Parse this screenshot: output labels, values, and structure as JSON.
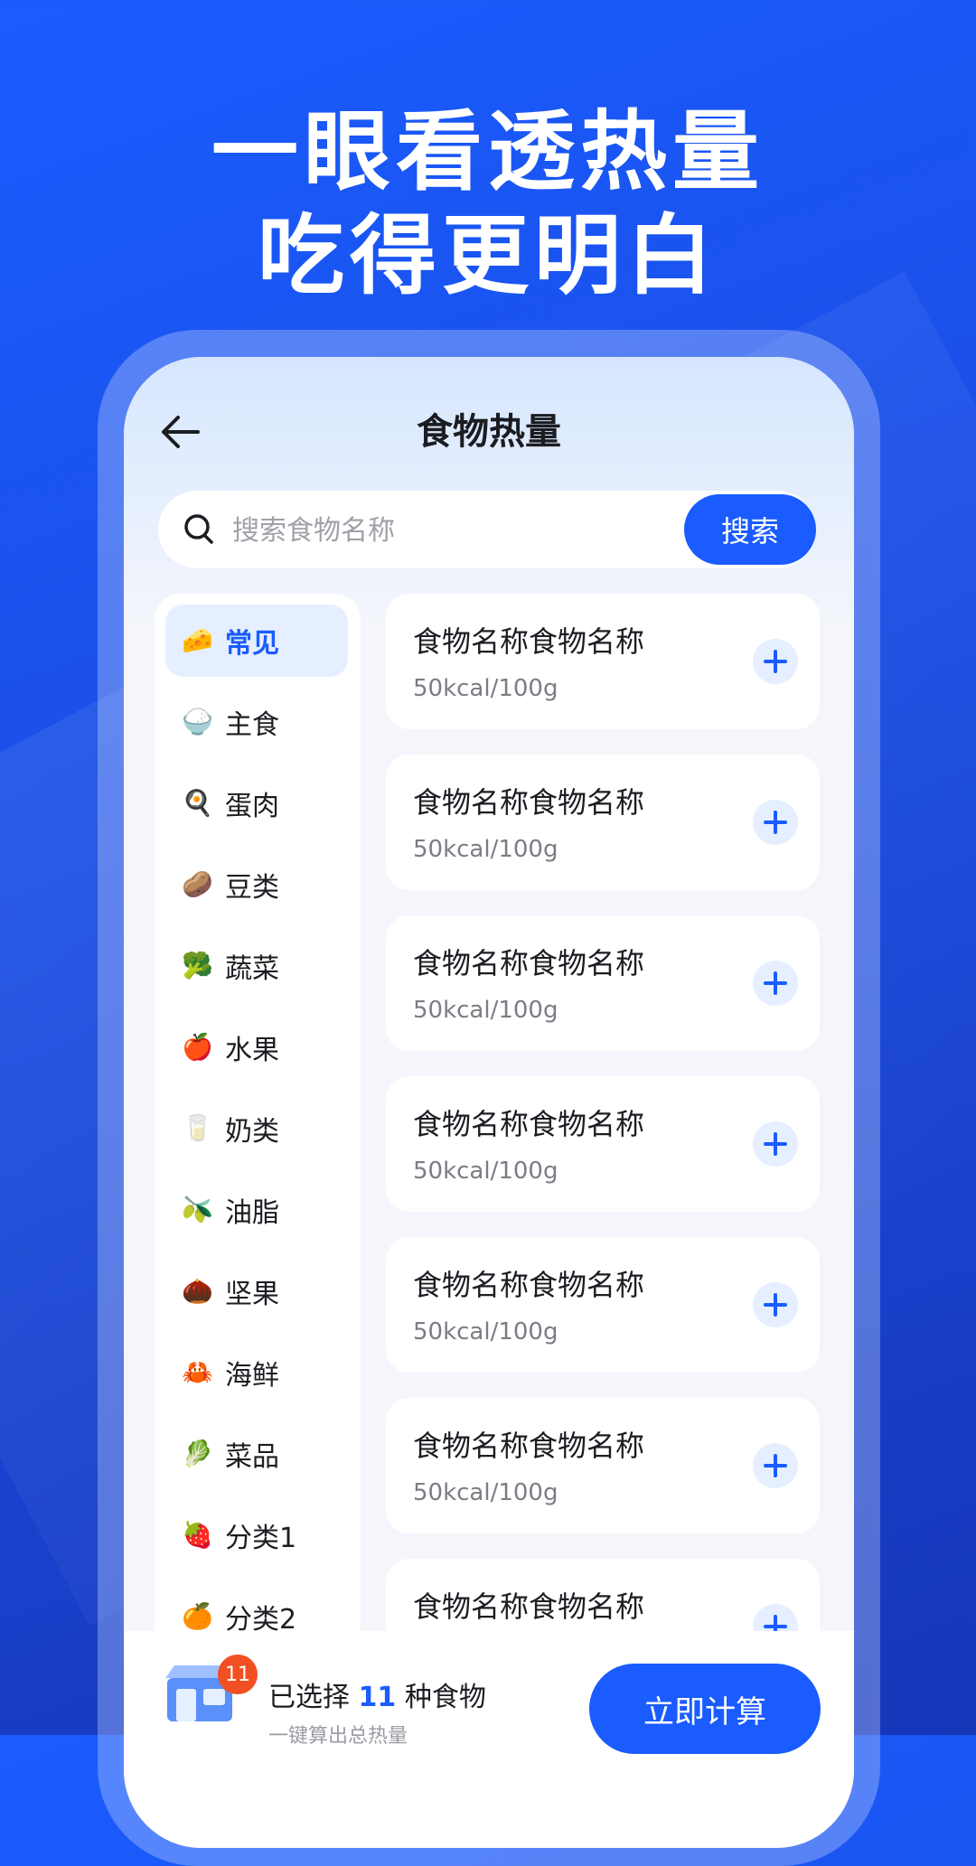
{
  "headline": {
    "line1": "一眼看透热量",
    "line2": "吃得更明白"
  },
  "nav": {
    "title": "食物热量",
    "back_icon": "arrow-left-icon"
  },
  "search": {
    "placeholder": "搜索食物名称",
    "button": "搜索"
  },
  "sidebar": {
    "items": [
      {
        "label": "常见",
        "icon": "🧀",
        "active": true
      },
      {
        "label": "主食",
        "icon": "🍚"
      },
      {
        "label": "蛋肉",
        "icon": "🍳"
      },
      {
        "label": "豆类",
        "icon": "🥔"
      },
      {
        "label": "蔬菜",
        "icon": "🥦"
      },
      {
        "label": "水果",
        "icon": "🍎"
      },
      {
        "label": "奶类",
        "icon": "🥛"
      },
      {
        "label": "油脂",
        "icon": "🫒"
      },
      {
        "label": "坚果",
        "icon": "🌰"
      },
      {
        "label": "海鲜",
        "icon": "🦀"
      },
      {
        "label": "菜品",
        "icon": "🥬"
      },
      {
        "label": "分类1",
        "icon": "🍓"
      },
      {
        "label": "分类2",
        "icon": "🍊"
      }
    ]
  },
  "foods": [
    {
      "name": "食物名称食物名称",
      "kcal": "50kcal/100g"
    },
    {
      "name": "食物名称食物名称",
      "kcal": "50kcal/100g"
    },
    {
      "name": "食物名称食物名称",
      "kcal": "50kcal/100g"
    },
    {
      "name": "食物名称食物名称",
      "kcal": "50kcal/100g"
    },
    {
      "name": "食物名称食物名称",
      "kcal": "50kcal/100g"
    },
    {
      "name": "食物名称食物名称",
      "kcal": "50kcal/100g"
    },
    {
      "name": "食物名称食物名称",
      "kcal": ""
    }
  ],
  "bottom": {
    "badge": "11",
    "selected_prefix": "已选择",
    "selected_count": "11",
    "selected_suffix": "种食物",
    "sub": "一键算出总热量",
    "button": "立即计算"
  },
  "colors": {
    "accent": "#1a5cff",
    "badge": "#f25022"
  }
}
